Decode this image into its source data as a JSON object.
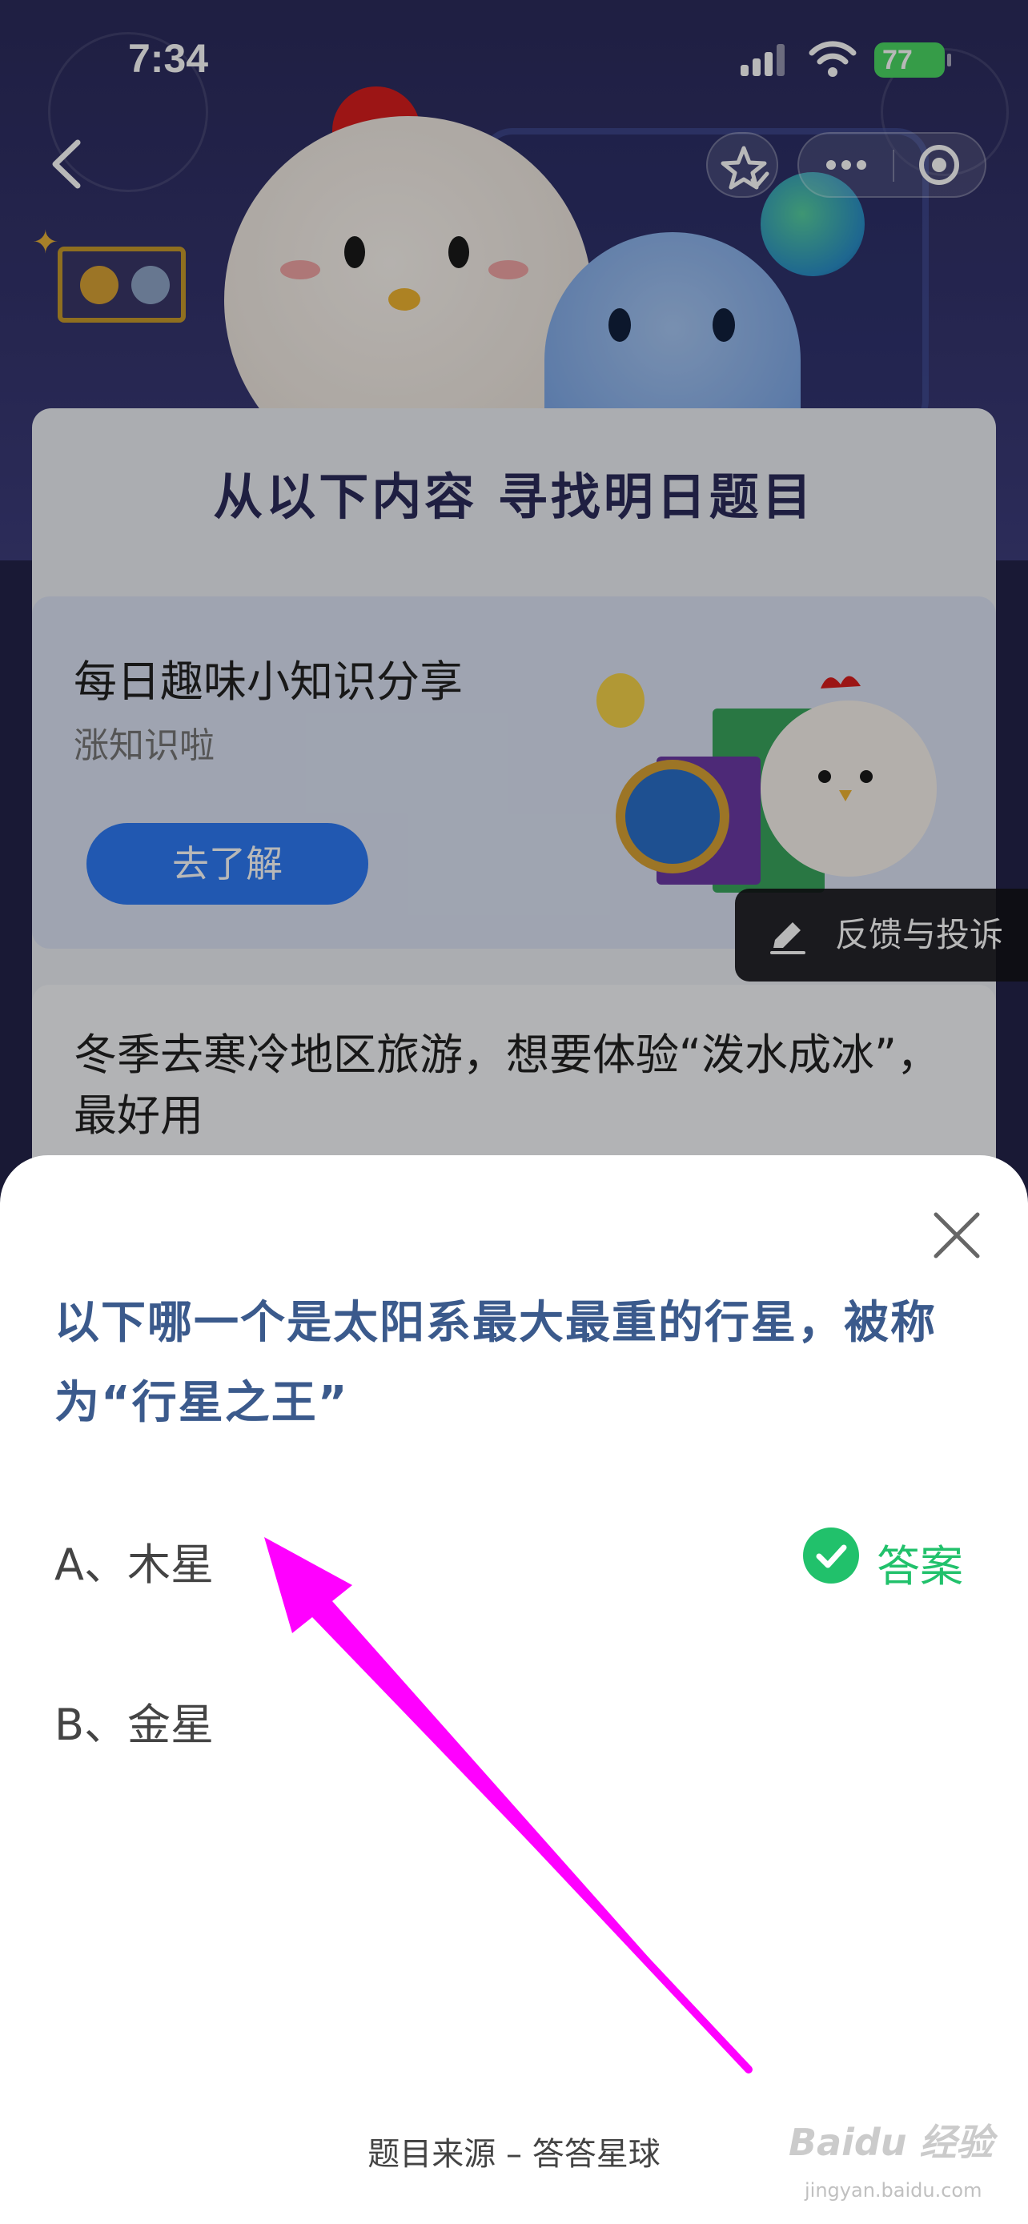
{
  "status_bar": {
    "time": "7:34",
    "battery": "77"
  },
  "nav": {
    "back_icon": "chevron-left-icon",
    "favorite_icon": "star-icon",
    "more_icon": "more-dots-icon",
    "close_icon": "target-circle-icon"
  },
  "main": {
    "heading": "从以下内容 寻找明日题目",
    "knowledge_card": {
      "title": "每日趣味小知识分享",
      "subtitle": "涨知识啦",
      "button": "去了解"
    },
    "question_card": {
      "text": "冬季去寒冷地区旅游，想要体验“泼水成冰”，最好用"
    },
    "feedback_button": "反馈与投诉"
  },
  "sheet": {
    "question": "以下哪一个是太阳系最大最重的行星，被称为“行星之王”",
    "options": [
      {
        "label": "A、木星",
        "is_answer": true
      },
      {
        "label": "B、金星",
        "is_answer": false
      }
    ],
    "answer_tag": "答案",
    "source": "题目来源 – 答答星球"
  },
  "watermark": {
    "brand": "Baidu 经验",
    "url": "jingyan.baidu.com"
  },
  "colors": {
    "accent_green": "#21c16b",
    "question_blue": "#3b5a8c",
    "arrow_magenta": "#ff00ff",
    "button_blue": "#2f7bf5"
  }
}
